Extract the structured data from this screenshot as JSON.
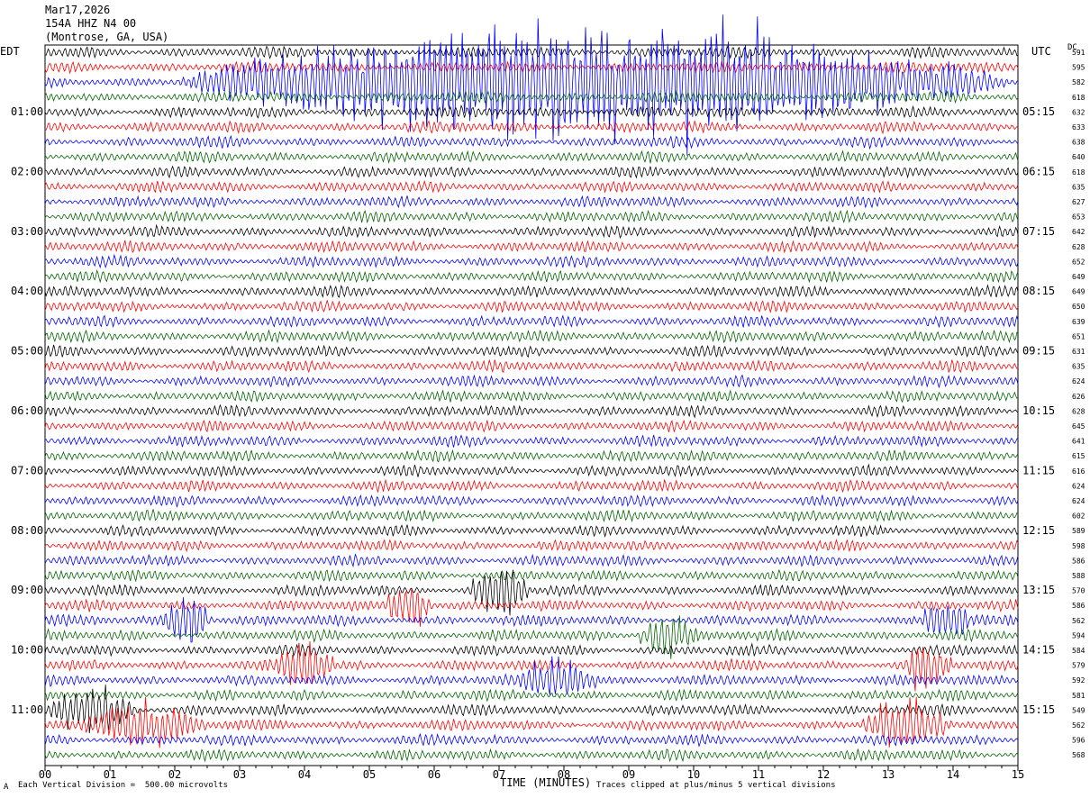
{
  "header": {
    "date": "Mar17,2026",
    "station": "154A HHZ N4 00",
    "location": "(Montrose, GA, USA)"
  },
  "footer": {
    "scale_note": "Each Vertical Division =  500.00 microvolts",
    "clip_note": "Traces clipped at plus/minus 5 vertical divisions",
    "corner_mark": "A"
  },
  "colors": {
    "black": "#000000",
    "red": "#ff0000",
    "blue": "#0000ff",
    "green": "#006400"
  },
  "chart_data": {
    "type": "line",
    "title": "",
    "xlabel": "TIME (MINUTES)",
    "ylabel": "",
    "left_axis_label": "EDT",
    "right_axis_label": "UTC",
    "dc_label": "DC",
    "x_ticks": [
      "00",
      "01",
      "02",
      "03",
      "04",
      "05",
      "06",
      "07",
      "08",
      "09",
      "10",
      "11",
      "12",
      "13",
      "14",
      "15"
    ],
    "xlim": [
      0,
      15
    ],
    "left_hour_labels": [
      "01:00",
      "02:00",
      "03:00",
      "04:00",
      "05:00",
      "06:00",
      "07:00",
      "08:00",
      "09:00",
      "10:00",
      "11:00"
    ],
    "right_hour_labels": [
      "05:15",
      "06:15",
      "07:15",
      "08:15",
      "09:15",
      "10:15",
      "11:15",
      "12:15",
      "13:15",
      "14:15",
      "15:15"
    ],
    "trace_colors_cycle": [
      "black",
      "red",
      "blue",
      "green"
    ],
    "dc_values": [
      591,
      595,
      582,
      618,
      632,
      633,
      638,
      640,
      618,
      635,
      627,
      653,
      642,
      628,
      652,
      649,
      649,
      650,
      639,
      651,
      631,
      635,
      624,
      626,
      628,
      645,
      641,
      615,
      616,
      624,
      624,
      602,
      589,
      598,
      586,
      588,
      570,
      586,
      562,
      594,
      584,
      579,
      592,
      581,
      549,
      562,
      596,
      568
    ],
    "events": [
      {
        "row": 2,
        "start_min": 1.9,
        "end_min": 15.0,
        "amp": 5.0
      },
      {
        "row": 36,
        "start_min": 6.5,
        "end_min": 7.5,
        "amp": 2.2
      },
      {
        "row": 37,
        "start_min": 5.2,
        "end_min": 6.0,
        "amp": 2.2
      },
      {
        "row": 38,
        "start_min": 1.8,
        "end_min": 2.6,
        "amp": 2.2
      },
      {
        "row": 38,
        "start_min": 13.5,
        "end_min": 14.3,
        "amp": 2.2
      },
      {
        "row": 39,
        "start_min": 9.1,
        "end_min": 10.1,
        "amp": 1.8
      },
      {
        "row": 41,
        "start_min": 3.5,
        "end_min": 4.5,
        "amp": 2.0
      },
      {
        "row": 41,
        "start_min": 13.2,
        "end_min": 14.0,
        "amp": 2.0
      },
      {
        "row": 42,
        "start_min": 7.3,
        "end_min": 8.6,
        "amp": 1.8
      },
      {
        "row": 44,
        "start_min": 0.0,
        "end_min": 1.5,
        "amp": 1.8
      },
      {
        "row": 45,
        "start_min": 0.5,
        "end_min": 2.5,
        "amp": 1.8
      },
      {
        "row": 45,
        "start_min": 12.5,
        "end_min": 14.0,
        "amp": 1.8
      }
    ]
  }
}
